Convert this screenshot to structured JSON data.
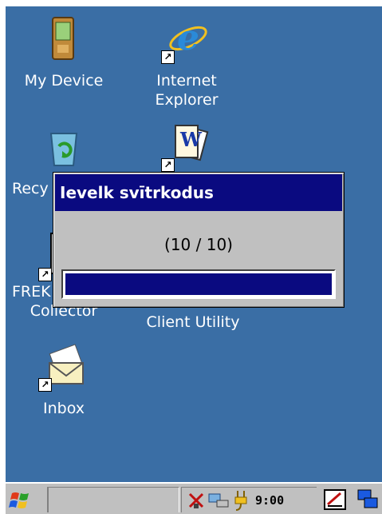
{
  "desktop": {
    "icons": [
      {
        "label_lines": [
          "My Device"
        ]
      },
      {
        "label_lines": [
          "Internet",
          "Explorer"
        ]
      },
      {
        "label_lines": [
          "Recy"
        ]
      },
      {
        "label_lines": [
          ""
        ]
      },
      {
        "label_lines": [
          "FREK",
          "Collector"
        ]
      },
      {
        "label_lines": [
          "Client Utility"
        ]
      },
      {
        "label_lines": [
          "Inbox"
        ]
      }
    ]
  },
  "dialog": {
    "title": "Ievelk svītrkodus",
    "progress_text": "(10 / 10)",
    "progress_fraction": 1.0
  },
  "taskbar": {
    "clock": "9:00"
  },
  "colors": {
    "desktop_bg": "#3a6ea5",
    "title_bar": "#0a0a80",
    "progress_fill": "#0a0a80",
    "taskbar_bg": "#c0c0c0"
  },
  "icons": {
    "start": "windows-flag-icon",
    "tray": [
      "network-disconnected-icon",
      "network-connection-icon",
      "power-plug-icon",
      "input-panel-icon",
      "desktop-switch-icon"
    ]
  }
}
